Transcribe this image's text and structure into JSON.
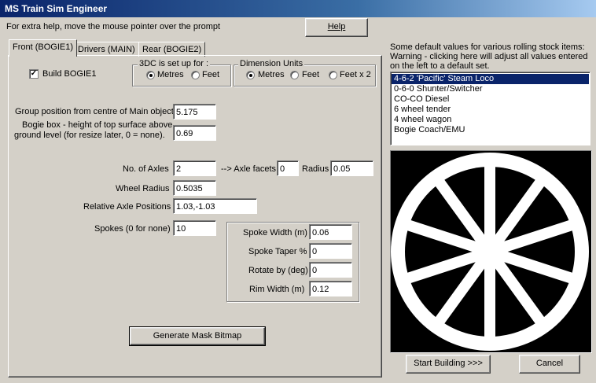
{
  "window": {
    "title": "MS Train Sim Engineer"
  },
  "help": {
    "hint": "For extra help, move the mouse pointer over the prompt",
    "button": "Help"
  },
  "tabs": [
    {
      "label": "Front (BOGIE1)"
    },
    {
      "label": "Drivers (MAIN)"
    },
    {
      "label": "Rear (BOGIE2)"
    }
  ],
  "build": {
    "label": "Build BOGIE1",
    "checked": true
  },
  "setup_3dc": {
    "caption": "3DC is set up for :",
    "options": [
      "Metres",
      "Feet"
    ],
    "selected": "Metres"
  },
  "dim_units": {
    "caption": "Dimension Units",
    "options": [
      "Metres",
      "Feet",
      "Feet x 2"
    ],
    "selected": "Metres"
  },
  "fields": {
    "group_position": {
      "label": "Group position from centre of Main object",
      "value": "5.175"
    },
    "bogie_box_line1": "Bogie box - height of top surface above",
    "bogie_box_line2": "ground level (for resize later, 0 = none).",
    "bogie_box_value": "0.69",
    "no_axles": {
      "label": "No. of Axles",
      "value": "2"
    },
    "axle_facets": {
      "label": "--> Axle facets",
      "value": "0"
    },
    "radius": {
      "label": "Radius",
      "value": "0.05"
    },
    "wheel_radius": {
      "label": "Wheel Radius",
      "value": "0.5035"
    },
    "relative_axle_positions": {
      "label": "Relative Axle Positions",
      "value": "1.03,-1.03"
    },
    "spokes": {
      "label": "Spokes (0 for none)",
      "value": "10"
    },
    "spoke_width": {
      "label": "Spoke Width (m)",
      "value": "0.06"
    },
    "spoke_taper": {
      "label": "Spoke Taper %",
      "value": "0"
    },
    "rotate_by": {
      "label": "Rotate by (deg)",
      "value": "0"
    },
    "rim_width": {
      "label": "Rim Width (m)",
      "value": "0.12"
    }
  },
  "generate_button": "Generate Mask Bitmap",
  "defaults": {
    "line1": "Some default values for various rolling stock items:",
    "line2": "Warning - clicking here will adjust all values entered",
    "line3": "on the left to a default set.",
    "items": [
      "4-6-2 'Pacific' Steam Loco",
      "0-6-0 Shunter/Switcher",
      "CO-CO Diesel",
      "6 wheel tender",
      "4 wheel wagon",
      "Bogie Coach/EMU"
    ],
    "selected_index": 0
  },
  "preview": {
    "spokes": 10,
    "icon": "wheel-preview"
  },
  "start_button": "Start Building >>>",
  "cancel_button": "Cancel"
}
